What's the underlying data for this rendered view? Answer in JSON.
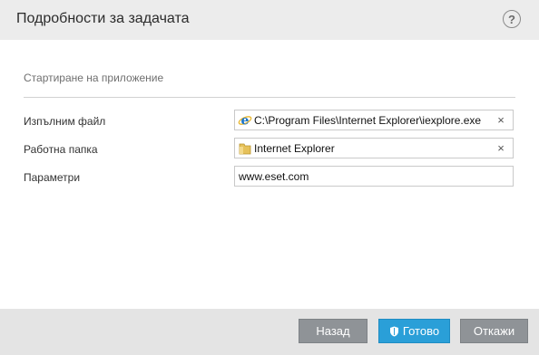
{
  "dialog": {
    "title": "Подробности за задачата",
    "help_label": "?"
  },
  "section": {
    "title": "Стартиране на приложение"
  },
  "fields": {
    "executable": {
      "label": "Изпълним файл",
      "value": "C:\\Program Files\\Internet Explorer\\iexplore.exe",
      "icon": "internet-explorer-icon",
      "clear": "×"
    },
    "working_folder": {
      "label": "Работна папка",
      "value": "Internet Explorer",
      "icon": "folder-icon",
      "clear": "×"
    },
    "parameters": {
      "label": "Параметри",
      "value": "www.eset.com"
    }
  },
  "buttons": {
    "back": "Назад",
    "finish": "Готово",
    "cancel": "Откажи"
  },
  "colors": {
    "primary_button": "#2a9fd8",
    "secondary_button": "#8f9397",
    "header_bg": "#ececec",
    "footer_bg": "#e4e4e4"
  }
}
